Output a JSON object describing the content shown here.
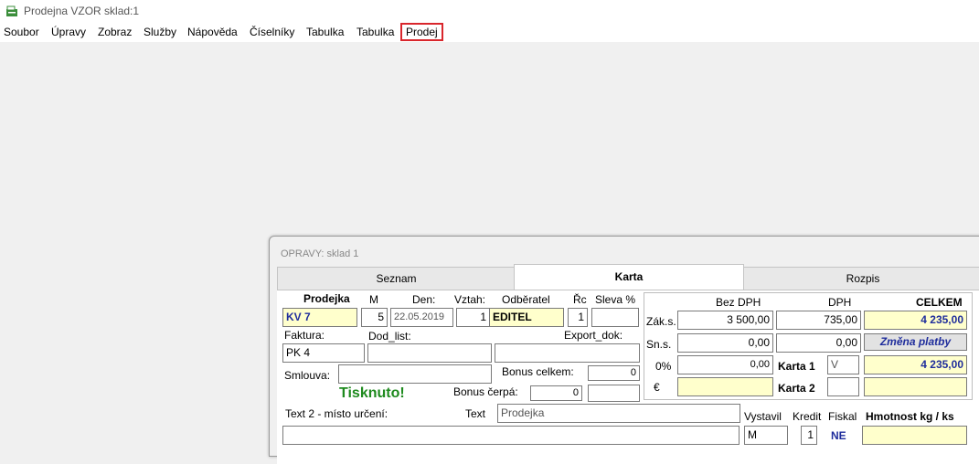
{
  "app": {
    "title": "Prodejna VZOR sklad:1"
  },
  "menu": {
    "items": [
      {
        "label": "Soubor"
      },
      {
        "label": "Úpravy"
      },
      {
        "label": "Zobraz"
      },
      {
        "label": "Služby"
      },
      {
        "label": "Nápověda"
      },
      {
        "label": "Číselníky"
      },
      {
        "label": "Tabulka"
      },
      {
        "label": "Tabulka"
      },
      {
        "label": "Prodej"
      }
    ]
  },
  "window": {
    "title": "OPRAVY: sklad 1",
    "tabs": [
      {
        "label": "Seznam"
      },
      {
        "label": "Karta"
      },
      {
        "label": "Rozpis"
      }
    ]
  },
  "form": {
    "labels": {
      "prodejka": "Prodejka",
      "m": "M",
      "den": "Den:",
      "vztah": "Vztah:",
      "odberatel": "Odběratel",
      "rc": "Řc",
      "sleva": "Sleva %",
      "faktura": "Faktura:",
      "dod_list": "Dod_list:",
      "export_dok": "Export_dok:",
      "smlouva": "Smlouva:",
      "bonus_celkem": "Bonus celkem:",
      "bonus_cerpa": "Bonus čerpá:",
      "text2": "Text 2 - místo určení:",
      "text": "Text",
      "vystavil": "Vystavil",
      "kredit": "Kredit",
      "fiskal": "Fiskal",
      "hmotnost": "Hmotnost kg / ks"
    },
    "values": {
      "prodejka": "KV   7",
      "m": "5",
      "den": "22.05.2019",
      "vztah": "1",
      "odberatel": "EDITEL",
      "rc": "1",
      "sleva": "",
      "faktura": "PK   4",
      "dod_list": "",
      "export_dok": "",
      "smlouva": "",
      "bonus_celkem": "0",
      "bonus_cerpa": "0",
      "bonus_cerpa2": "",
      "status": "Tisknuto!",
      "text": "Prodejka",
      "text2": "",
      "vystavil": "M",
      "kredit": "1",
      "fiskal": "NE",
      "hmotnost": ""
    }
  },
  "totals": {
    "headers": {
      "bez_dph": "Bez DPH",
      "dph": "DPH",
      "celkem": "CELKEM"
    },
    "rows": {
      "zak_s": {
        "label": "Zák.s.",
        "bez_dph": "3 500,00",
        "dph": "735,00",
        "celkem": "4 235,00"
      },
      "sn_s": {
        "label": "Sn.s.",
        "bez_dph": "0,00",
        "dph": "0,00"
      },
      "zero": {
        "label": "0%",
        "bez_dph": "0,00"
      },
      "euro": {
        "label": "€",
        "bez_dph": ""
      }
    },
    "zmena_platby": "Změna platby",
    "karta1": {
      "label": "Karta 1",
      "code": "V",
      "amount": "4 235,00"
    },
    "karta2": {
      "label": "Karta 2",
      "code": "",
      "amount": ""
    }
  },
  "colors": {
    "highlight_border": "#d9262c",
    "field_yellow": "#ffffcc",
    "accent_blue": "#1f2d9c",
    "status_green": "#1e8a1e"
  }
}
